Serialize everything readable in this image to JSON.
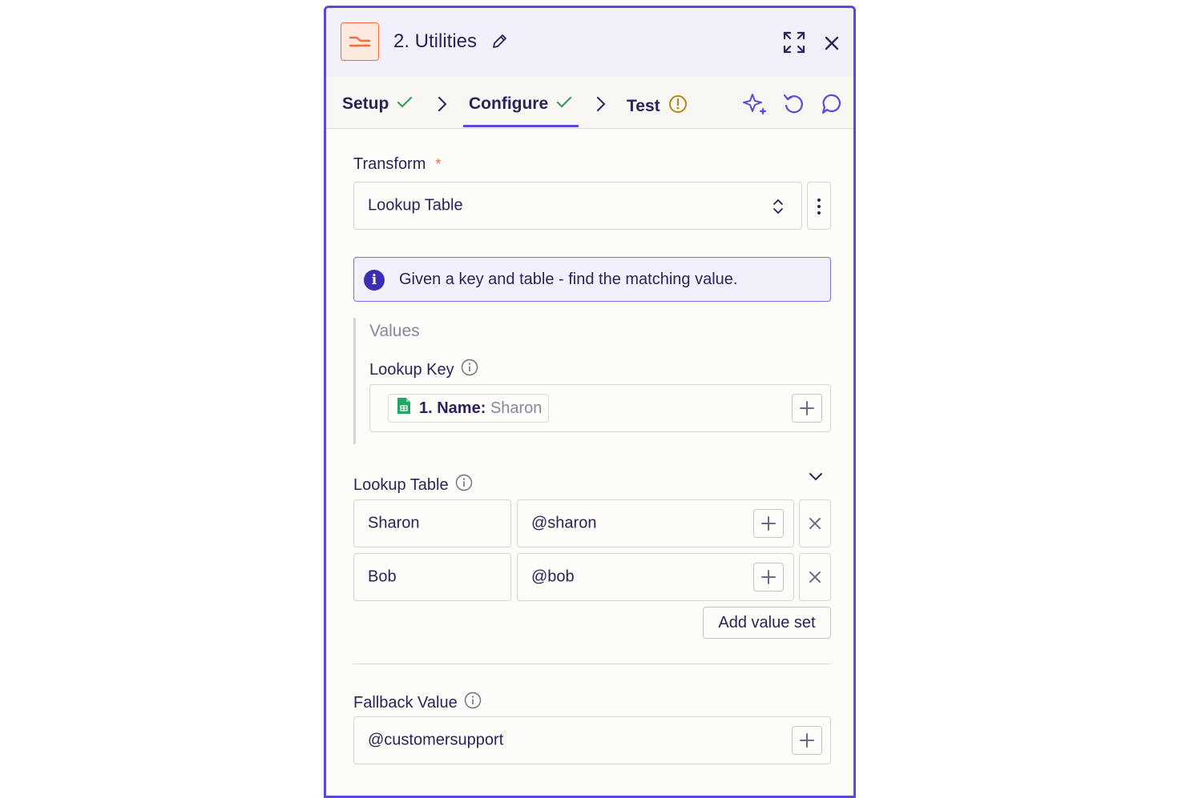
{
  "header": {
    "title": "2. Utilities"
  },
  "tabs": [
    {
      "label": "Setup",
      "status": "complete"
    },
    {
      "label": "Configure",
      "status": "complete",
      "active": true
    },
    {
      "label": "Test",
      "status": "warning"
    }
  ],
  "transform": {
    "label": "Transform",
    "required_mark": "*",
    "selected": "Lookup Table"
  },
  "info_banner": {
    "text": "Given a key and table - find the matching value."
  },
  "values": {
    "heading": "Values",
    "lookup_key": {
      "label": "Lookup Key",
      "pill_step": "1. Name:",
      "pill_value": "Sharon"
    }
  },
  "lookup_table": {
    "label": "Lookup Table",
    "rows": [
      {
        "key": "Sharon",
        "value": "@sharon"
      },
      {
        "key": "Bob",
        "value": "@bob"
      }
    ],
    "add_button": "Add value set"
  },
  "fallback": {
    "label": "Fallback Value",
    "value": "@customersupport"
  },
  "colors": {
    "accent": "#5a49d6",
    "brand_orange": "#f26b3a",
    "check_green": "#3a9a5b",
    "warning_gold": "#b08a12"
  },
  "icons": [
    "utilities-icon",
    "pencil-icon",
    "expand-icon",
    "close-icon",
    "check-icon",
    "chevron-right-icon",
    "warning-icon",
    "sparkle-icon",
    "undo-icon",
    "comment-icon",
    "updown-icon",
    "more-vertical-icon",
    "info-icon",
    "sheets-icon",
    "plus-icon",
    "chevron-down-icon"
  ]
}
